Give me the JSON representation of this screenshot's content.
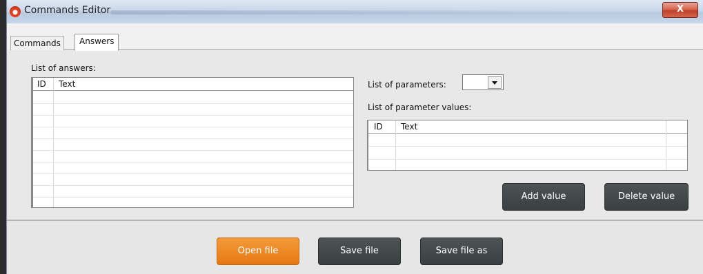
{
  "window": {
    "title": "Commands Editor",
    "close_glyph": "X"
  },
  "tabs": [
    {
      "label": "Commands",
      "active": false
    },
    {
      "label": "Answers",
      "active": true
    }
  ],
  "answers": {
    "label": "List of answers:",
    "columns": [
      "ID",
      "Text"
    ],
    "rows": []
  },
  "parameters": {
    "label": "List of parameters:",
    "selected": ""
  },
  "parameter_values": {
    "label": "List of parameter values:",
    "columns": [
      "ID",
      "Text"
    ],
    "rows": []
  },
  "buttons": {
    "add_value": "Add value",
    "delete_value": "Delete value",
    "open_file": "Open file",
    "save_file": "Save file",
    "save_file_as": "Save file as"
  },
  "colors": {
    "accent_orange": "#e67812",
    "dark_button": "#3a3f41",
    "close_red": "#c1412a"
  },
  "icons": {
    "app": "app-logo-icon",
    "close": "close-icon",
    "dropdown": "chevron-down-icon"
  }
}
